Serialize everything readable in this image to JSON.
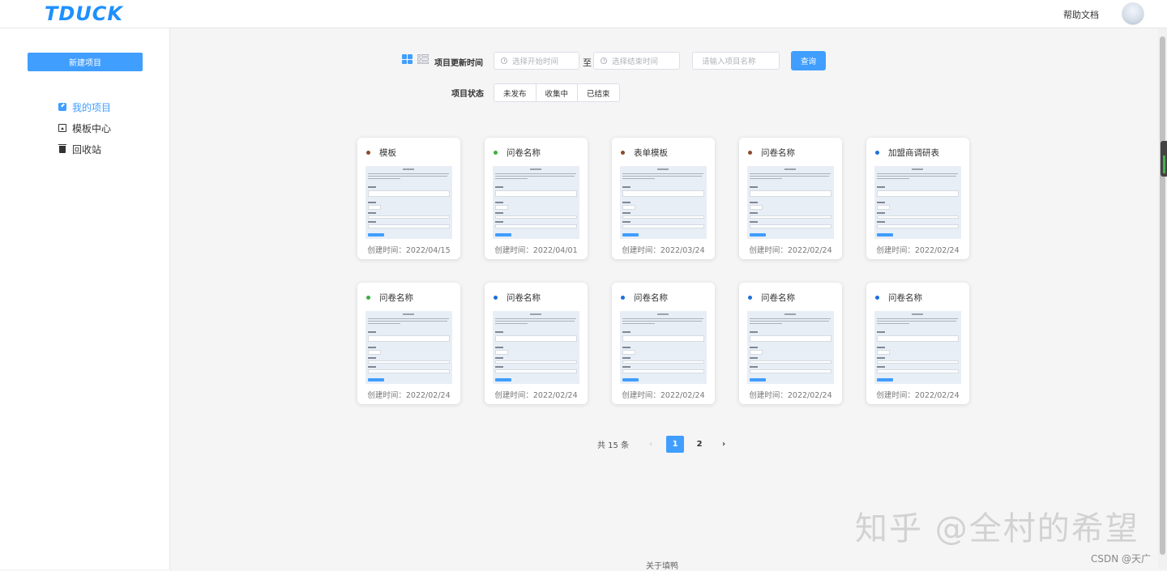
{
  "header": {
    "logo": "TDUCK",
    "help": "帮助文档",
    "avatar_icon": "user-avatar-icon"
  },
  "sidebar": {
    "new_button": "新建项目",
    "items": [
      {
        "label": "我的项目",
        "icon": "edit-icon",
        "active": true
      },
      {
        "label": "模板中心",
        "icon": "template-icon",
        "active": false
      },
      {
        "label": "回收站",
        "icon": "trash-icon",
        "active": false
      }
    ]
  },
  "filters": {
    "update_time_label": "项目更新时间",
    "start_placeholder": "选择开始时间",
    "to": "至",
    "end_placeholder": "选择结束时间",
    "name_placeholder": "请输入项目名称",
    "query_button": "查询",
    "status_label": "项目状态",
    "status_options": [
      "未发布",
      "收集中",
      "已结束"
    ]
  },
  "cards": [
    {
      "title": "模板",
      "date": "创建时间：2022/04/15",
      "dot_color": "#8b4a2f"
    },
    {
      "title": "问卷名称",
      "date": "创建时间：2022/04/01",
      "dot_color": "#3cb043"
    },
    {
      "title": "表单模板",
      "date": "创建时间：2022/03/24",
      "dot_color": "#8b4a2f"
    },
    {
      "title": "问卷名称",
      "date": "创建时间：2022/02/24",
      "dot_color": "#8b4a2f"
    },
    {
      "title": "加盟商调研表",
      "date": "创建时间：2022/02/24",
      "dot_color": "#1e6fd9"
    },
    {
      "title": "问卷名称",
      "date": "创建时间：2022/02/24",
      "dot_color": "#3cb043"
    },
    {
      "title": "问卷名称",
      "date": "创建时间：2022/02/24",
      "dot_color": "#1e6fd9"
    },
    {
      "title": "问卷名称",
      "date": "创建时间：2022/02/24",
      "dot_color": "#1e6fd9"
    },
    {
      "title": "问卷名称",
      "date": "创建时间：2022/02/24",
      "dot_color": "#1e6fd9"
    },
    {
      "title": "问卷名称",
      "date": "创建时间：2022/02/24",
      "dot_color": "#1e6fd9"
    }
  ],
  "pagination": {
    "total": "共 15 条",
    "pages": [
      "1",
      "2"
    ],
    "current": "1",
    "prev": "‹",
    "next": "›"
  },
  "footer": {
    "about": "关于填鸭"
  },
  "watermark": {
    "zhihu": "知乎 @全村的希望",
    "csdn": "CSDN @天广"
  },
  "colors": {
    "accent": "#409eff"
  }
}
